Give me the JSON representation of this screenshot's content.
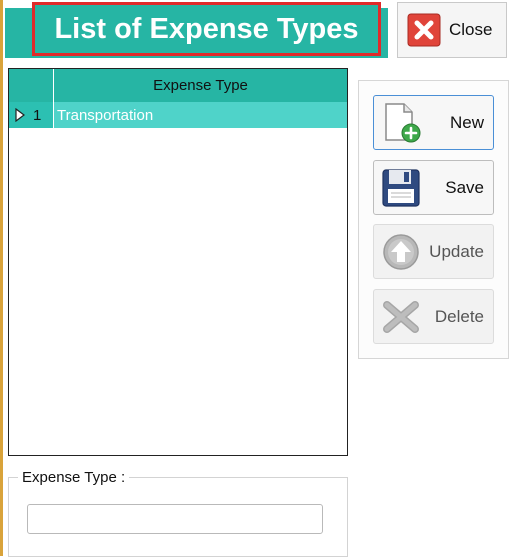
{
  "header": {
    "title": "List of Expense Types"
  },
  "toolbar": {
    "close_label": "Close"
  },
  "grid": {
    "column_header": "Expense Type",
    "rows": [
      {
        "number": "1",
        "value": "Transportation"
      }
    ]
  },
  "actions": {
    "new_label": "New",
    "save_label": "Save",
    "update_label": "Update",
    "delete_label": "Delete"
  },
  "form": {
    "expense_type_label": "Expense Type :",
    "expense_type_value": ""
  },
  "colors": {
    "accent": "#26b5a4",
    "row_selected": "#4fd3c9",
    "title_outline": "#e02a2a"
  },
  "icons": {
    "close": "close-x-icon",
    "new": "new-document-icon",
    "save": "floppy-disk-icon",
    "update": "upload-arrow-icon",
    "delete": "delete-x-icon",
    "row_pointer": "row-pointer-icon"
  }
}
